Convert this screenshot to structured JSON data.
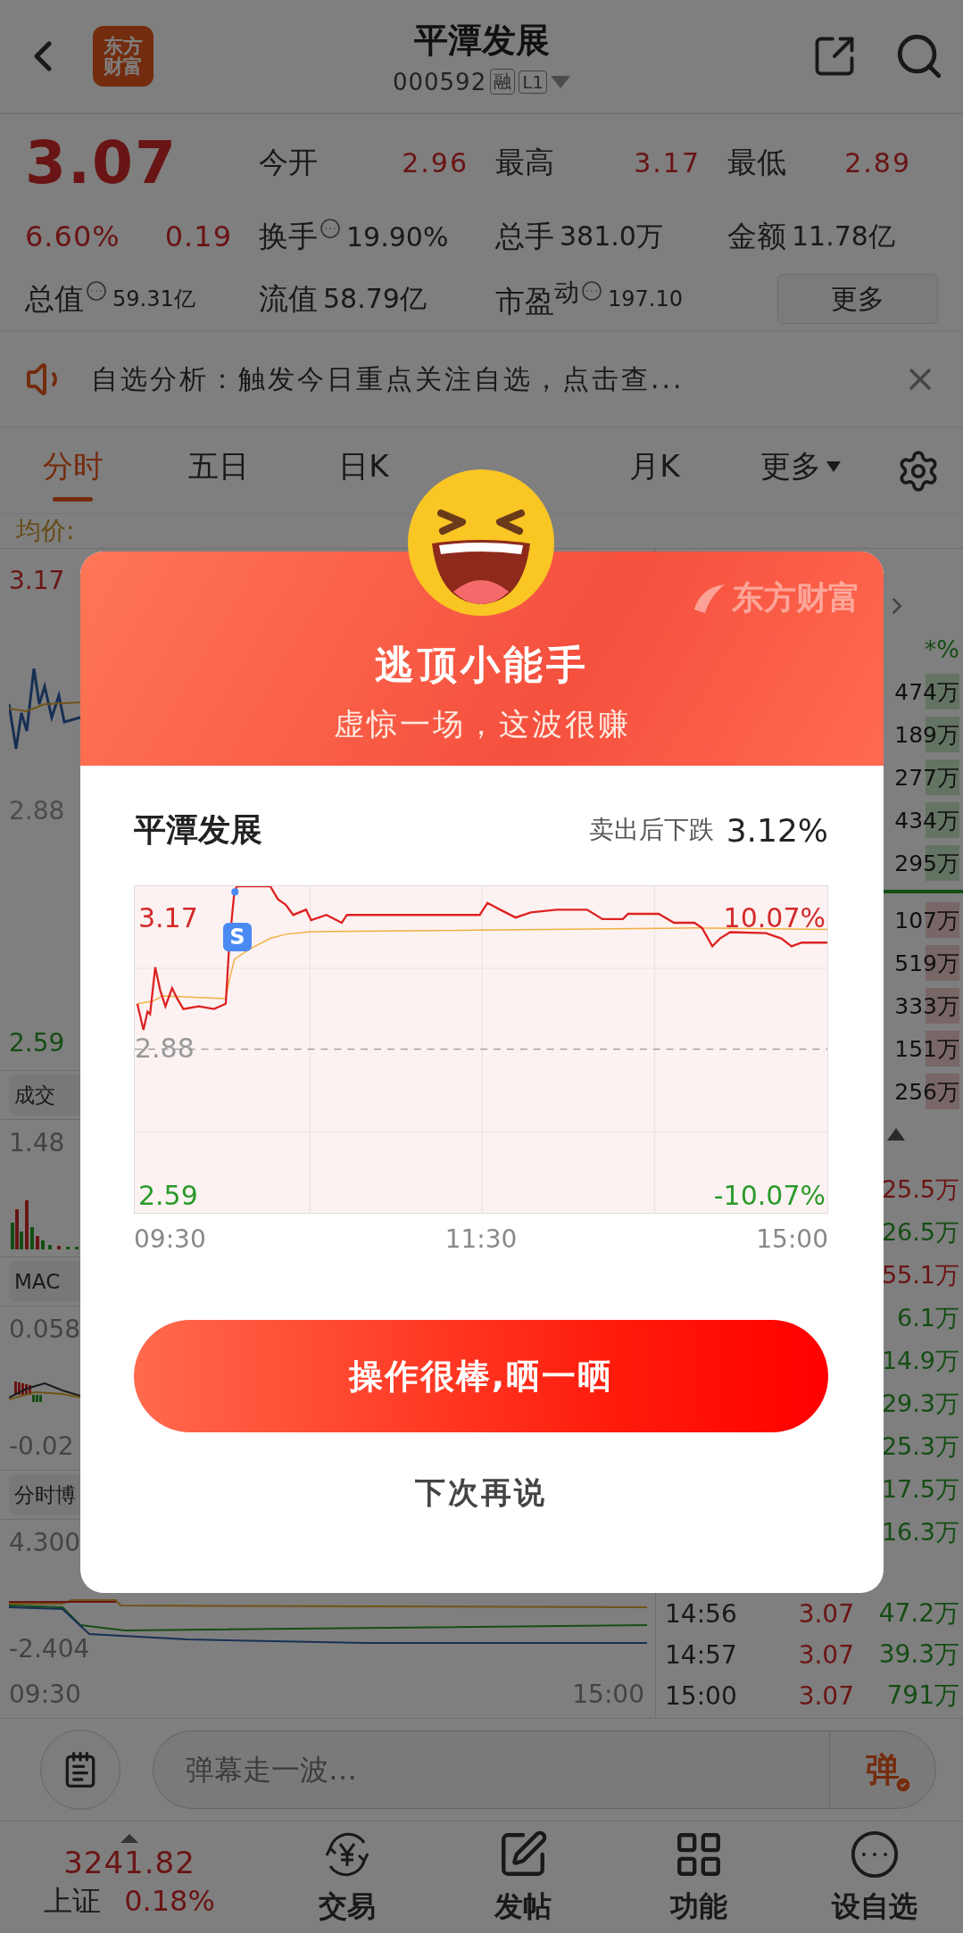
{
  "header": {
    "logo": [
      "东方",
      "财富"
    ],
    "title": "平潭发展",
    "code": "000592",
    "badges": [
      "融",
      "L1"
    ]
  },
  "quote": {
    "price": "3.07",
    "change_pct": "6.60%",
    "change": "0.19",
    "more": "更多",
    "stats": [
      {
        "label": "今开",
        "value": "2.96",
        "kind": "price",
        "info": false
      },
      {
        "label": "最高",
        "value": "3.17",
        "kind": "price",
        "info": false
      },
      {
        "label": "最低",
        "value": "2.89",
        "kind": "price",
        "info": false
      },
      {
        "label": "换手",
        "value": "19.90%",
        "kind": "plain",
        "info": true
      },
      {
        "label": "总手",
        "value": "381.0万",
        "kind": "plain",
        "info": false
      },
      {
        "label": "金额",
        "value": "11.78亿",
        "kind": "plain",
        "info": false
      },
      {
        "label": "总值",
        "value": "59.31亿",
        "kind": "small",
        "info": true
      },
      {
        "label": "流值",
        "value": "58.79亿",
        "kind": "plain",
        "info": false
      },
      {
        "label": "市盈$^{动}$",
        "value": "197.10",
        "kind": "small",
        "info": true
      }
    ]
  },
  "notice": {
    "text": "自选分析：触发今日重点关注自选，点击查..."
  },
  "tabs": [
    {
      "label": "分时",
      "selected": true,
      "kind": "tab"
    },
    {
      "label": "五日",
      "selected": false,
      "kind": "tab"
    },
    {
      "label": "日K",
      "selected": false,
      "kind": "tab"
    },
    {
      "label": "月K",
      "selected": false,
      "kind": "tab"
    },
    {
      "label": "更多",
      "selected": false,
      "kind": "menu"
    }
  ],
  "avg_label": "均价:",
  "intraday": {
    "price_labels": [
      {
        "text": "3.17",
        "kind": "high"
      },
      {
        "text": "2.88",
        "kind": "base"
      },
      {
        "text": "2.59",
        "kind": "low"
      }
    ],
    "volume_tab": "成交",
    "volume_label": "1.48",
    "macd_tab": "MAC",
    "macd_labels": [
      "0.058",
      "-0.02"
    ],
    "game_tab": "分时博",
    "game_labels": [
      "4.300",
      "-2.404"
    ],
    "times": [
      "09:30",
      "15:00"
    ]
  },
  "side": {
    "header": "*%",
    "sell_volumes": [
      "474万",
      "189万",
      "277万",
      "434万",
      "295万"
    ],
    "buy_volumes": [
      "107万",
      "519万",
      "333万",
      "151万",
      "256万"
    ],
    "ticks": [
      {
        "volume": "25.5万",
        "kind": "up"
      },
      {
        "volume": "26.5万",
        "kind": "down"
      },
      {
        "volume": "55.1万",
        "kind": "up"
      },
      {
        "volume": "6.1万",
        "kind": "down"
      },
      {
        "volume": "14.9万",
        "kind": "down"
      },
      {
        "volume": "29.3万",
        "kind": "down"
      },
      {
        "volume": "25.3万",
        "kind": "down"
      },
      {
        "volume": "17.5万",
        "kind": "down"
      },
      {
        "volume": "16.3万",
        "kind": "down"
      }
    ],
    "trades": [
      {
        "time": "14:56",
        "price": "3.07",
        "volume": "47.2万",
        "kind": "down"
      },
      {
        "time": "14:57",
        "price": "3.07",
        "volume": "39.3万",
        "kind": "down"
      },
      {
        "time": "15:00",
        "price": "3.07",
        "volume": "791万",
        "kind": "down"
      }
    ]
  },
  "comment_bar": {
    "placeholder": "弹幕走一波…",
    "send": "弹"
  },
  "index": {
    "value": "3241.82",
    "name": "上证",
    "change": "0.18%"
  },
  "nav": [
    {
      "label": "交易",
      "kind": "trade"
    },
    {
      "label": "发帖",
      "kind": "post"
    },
    {
      "label": "功能",
      "kind": "apps"
    },
    {
      "label": "设自选",
      "kind": "more"
    }
  ],
  "popup": {
    "brand": "东方财富",
    "title": "逃顶小能手",
    "subtitle": "虚惊一场，这波很赚",
    "stock": "平潭发展",
    "result_label": "卖出后下跌",
    "result_value": "3.12%",
    "chart": {
      "price_high": "3.17",
      "pct_high": "10.07%",
      "price_base": "2.88",
      "price_low": "2.59",
      "pct_low": "-10.07%",
      "marker": "S",
      "times": [
        "09:30",
        "11:30",
        "15:00"
      ]
    },
    "primary_button": "操作很棒,晒一晒",
    "secondary_button": "下次再说"
  }
}
